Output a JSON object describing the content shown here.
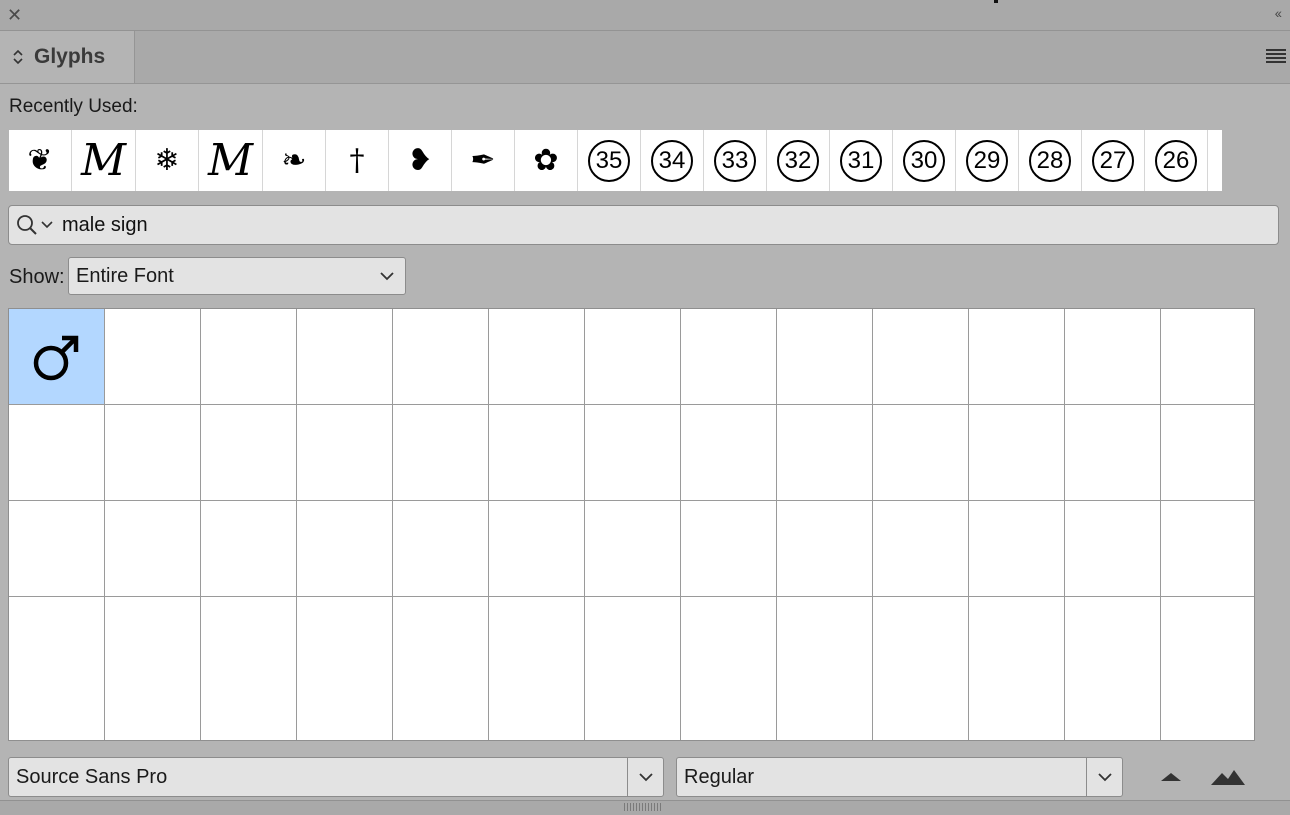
{
  "window": {
    "close_glyph": "✕",
    "collapse_glyph": "‹‹"
  },
  "panel": {
    "tab_title": "Glyphs",
    "tab_arrows": "⌃⌄",
    "menu_icon": "hamburger-icon"
  },
  "recently_used": {
    "label": "Recently Used:",
    "items": [
      {
        "glyph": "❦",
        "kind": "ornament"
      },
      {
        "glyph": "M",
        "kind": "script"
      },
      {
        "glyph": "❄",
        "kind": "ornament"
      },
      {
        "glyph": "M",
        "kind": "script"
      },
      {
        "glyph": "❧",
        "kind": "ornament"
      },
      {
        "glyph": "†",
        "kind": "ornament"
      },
      {
        "glyph": "❥",
        "kind": "ornament"
      },
      {
        "glyph": "✒",
        "kind": "ornament"
      },
      {
        "glyph": "✿",
        "kind": "ornament"
      },
      {
        "glyph": "35",
        "kind": "circled"
      },
      {
        "glyph": "34",
        "kind": "circled"
      },
      {
        "glyph": "33",
        "kind": "circled"
      },
      {
        "glyph": "32",
        "kind": "circled"
      },
      {
        "glyph": "31",
        "kind": "circled"
      },
      {
        "glyph": "30",
        "kind": "circled"
      },
      {
        "glyph": "29",
        "kind": "circled"
      },
      {
        "glyph": "28",
        "kind": "circled"
      },
      {
        "glyph": "27",
        "kind": "circled"
      },
      {
        "glyph": "26",
        "kind": "circled"
      }
    ]
  },
  "search": {
    "value": "male sign"
  },
  "show": {
    "label": "Show:",
    "selected": "Entire Font"
  },
  "glyph_grid": {
    "selected_glyph": "♂",
    "selected_color": "#b3d7ff"
  },
  "font_family": {
    "selected": "Source Sans Pro"
  },
  "font_style": {
    "selected": "Regular"
  },
  "zoom": {
    "out_icon": "zoom-out-mountain-icon",
    "in_icon": "zoom-in-mountains-icon"
  }
}
